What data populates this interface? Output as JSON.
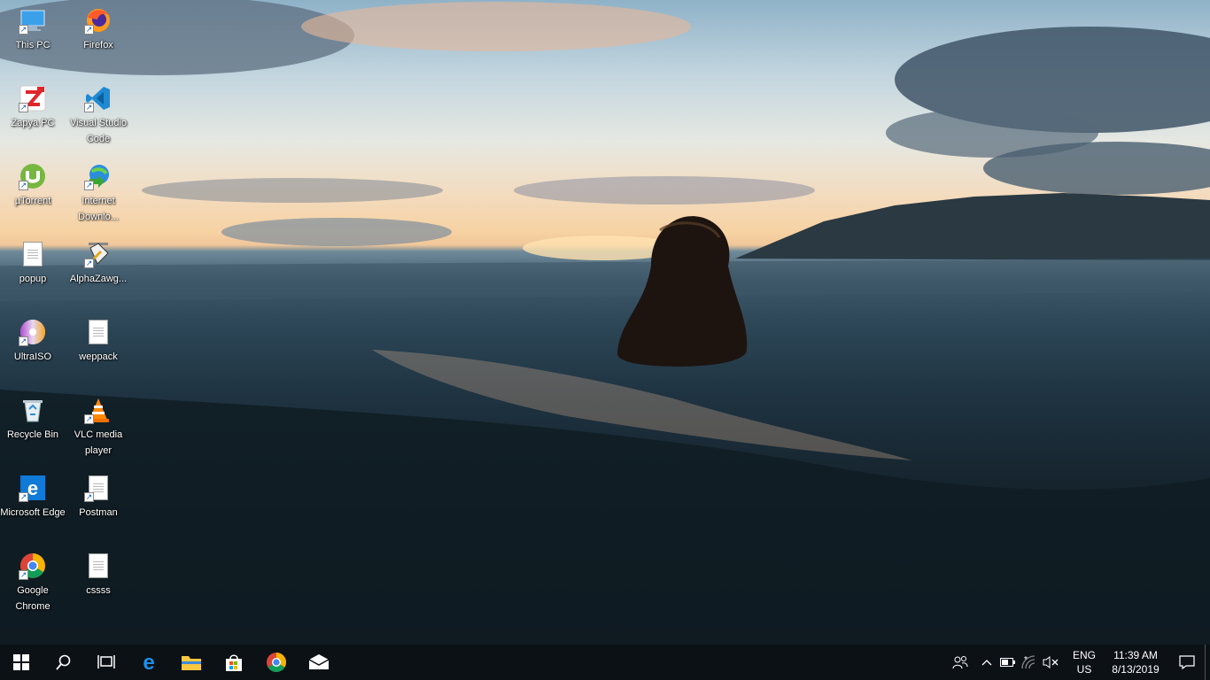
{
  "desktop": {
    "icons": [
      {
        "label": "This PC",
        "icon": "this-pc-icon"
      },
      {
        "label": "Firefox",
        "icon": "firefox-icon"
      },
      {
        "label": "Zapya PC",
        "icon": "zapya-icon"
      },
      {
        "label": "Visual Studio Code",
        "icon": "vscode-icon"
      },
      {
        "label": "µTorrent",
        "icon": "utorrent-icon"
      },
      {
        "label": "Internet Downlo...",
        "icon": "idm-icon"
      },
      {
        "label": "popup",
        "icon": "document-icon"
      },
      {
        "label": "AlphaZawg...",
        "icon": "alphazawg-icon"
      },
      {
        "label": "UltraISO",
        "icon": "ultraiso-icon"
      },
      {
        "label": "weppack",
        "icon": "document-icon"
      },
      {
        "label": "Recycle Bin",
        "icon": "recycle-bin-icon"
      },
      {
        "label": "VLC media player",
        "icon": "vlc-icon"
      },
      {
        "label": "Microsoft Edge",
        "icon": "edge-icon"
      },
      {
        "label": "Postman",
        "icon": "document-icon"
      },
      {
        "label": "Google Chrome",
        "icon": "chrome-icon"
      },
      {
        "label": "cssss",
        "icon": "document-icon"
      }
    ]
  },
  "taskbar": {
    "pinned": [
      "start-icon",
      "search-icon",
      "task-view-icon",
      "edge-icon",
      "file-explorer-icon",
      "store-icon",
      "chrome-icon",
      "mail-icon"
    ],
    "tray": {
      "lang_line1": "ENG",
      "lang_line2": "US",
      "time": "11:39 AM",
      "date": "8/13/2019"
    }
  },
  "colors": {
    "taskbar_bg": "#0c1116",
    "accent": "#0078d7"
  }
}
